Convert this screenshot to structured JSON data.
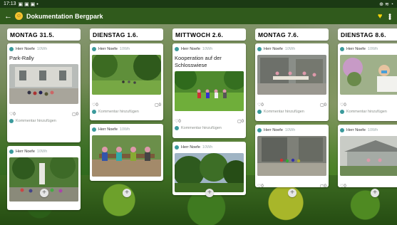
{
  "status_bar": {
    "time": "17:13",
    "icons_left": "▣ ▣ ▣ •",
    "icons_right": "⊕ ≋ ◔"
  },
  "topbar": {
    "back_icon": "←",
    "title": "Dokumentation Bergpark",
    "heart_icon": "♥",
    "more_icon": "•••"
  },
  "colors": {
    "header": "#305a1c",
    "statusbar": "#1b3a14",
    "heart": "#f5d40a",
    "avatar": "#3b9a9c"
  },
  "comment_placeholder": "Kommentar hinzufügen",
  "columns": [
    {
      "title": "MONTAG 31.5.",
      "cards": [
        {
          "author": "Herr Noefe",
          "time": "10Wh",
          "title": "Park-Rally",
          "likes": "0",
          "comments": "0",
          "photo": "castle-steps-group"
        },
        {
          "author": "Herr Noefe",
          "time": "10Wh",
          "title": "",
          "photo": "statue-garden"
        }
      ]
    },
    {
      "title": "DIENSTAG 1.6.",
      "cards": [
        {
          "author": "Herr Noefe",
          "time": "10Wh",
          "title": "",
          "likes": "0",
          "comments": "0",
          "photo": "lawn-trees"
        },
        {
          "author": "Herr Noefe",
          "time": "10Wh",
          "title": "",
          "photo": "children-bench"
        }
      ]
    },
    {
      "title": "MITTWOCH 2.6.",
      "cards": [
        {
          "author": "Herr Noefe",
          "time": "10Wh",
          "title": "Kooperation auf der Schlosswiese",
          "likes": "0",
          "comments": "0",
          "photo": "meadow-group"
        },
        {
          "author": "Herr Noefe",
          "time": "10Wh",
          "title": "",
          "photo": "forest-trees"
        }
      ]
    },
    {
      "title": "MONTAG 7.6.",
      "cards": [
        {
          "author": "Herr Noefe",
          "time": "10Wh",
          "title": "",
          "likes": "0",
          "comments": "0",
          "photo": "ruins-table"
        },
        {
          "author": "Herr Noefe",
          "time": "10Wh",
          "title": "",
          "likes": "0",
          "comments": "0",
          "photo": "ruins-children"
        }
      ]
    },
    {
      "title": "DIENSTAG 8.6.",
      "cards": [
        {
          "author": "Herr Noefe",
          "time": "10Wh",
          "title": "",
          "likes": "0",
          "comments": "0",
          "photo": "woman-mask-poster"
        },
        {
          "author": "Herr Noefe",
          "time": "10Wh",
          "title": "",
          "likes": "0",
          "comments": "0",
          "photo": "pavilion"
        }
      ]
    }
  ],
  "add_icon": "+"
}
